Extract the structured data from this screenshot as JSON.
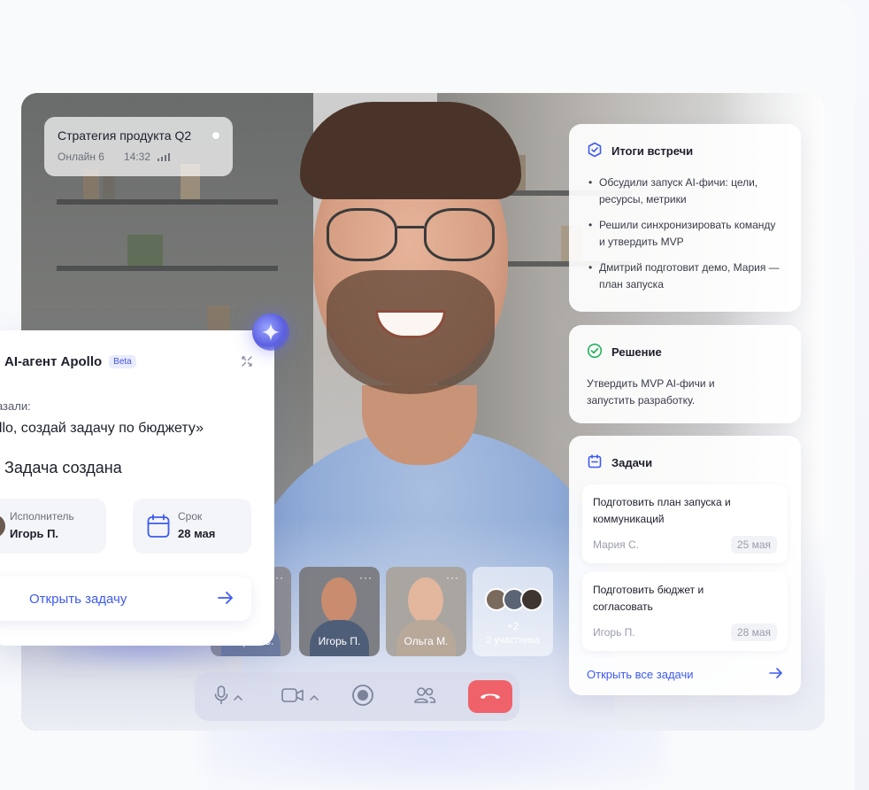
{
  "meeting": {
    "title": "Стратегия продукта Q2",
    "online": "Онлайн 6",
    "time": "14:32"
  },
  "summary": {
    "title": "Итоги встречи",
    "items": [
      "Обсудили запуск AI-фичи: цели, ресурсы, метрики",
      "Решили синхронизировать команду и утвердить MVP",
      "Дмитрий подготовит демо, Мария — план запуска"
    ]
  },
  "decision": {
    "title": "Решение",
    "text": "Утвердить MVP AI-фичи и запустить разработку."
  },
  "tasks": {
    "title": "Задачи",
    "items": [
      {
        "title": "Подготовить план запуска и коммуникаций",
        "assignee": "Мария С.",
        "date": "25 мая"
      },
      {
        "title": "Подготовить бюджет и согласовать",
        "assignee": "Игорь П.",
        "date": "28 мая"
      }
    ],
    "open_all": "Открыть все задачи"
  },
  "participants": {
    "tiles": [
      {
        "name": "Мария С."
      },
      {
        "name": "Игорь П."
      },
      {
        "name": "Ольга М."
      }
    ],
    "more_plus": "+2",
    "more_count": "2 участника"
  },
  "agent": {
    "name": "AI-агент Apollo",
    "badge": "Beta",
    "said_label": "казали:",
    "quote": "ollo, создай задачу по бюджету»",
    "created": "Задача создана",
    "assignee_label": "Исполнитель",
    "assignee_value": "Игорь П.",
    "due_label": "Срок",
    "due_value": "28 мая",
    "open_button": "Открыть задачу"
  },
  "colors": {
    "accent": "#3d5af1",
    "success": "#22b35e",
    "end_call": "#f0626a"
  },
  "icons": {
    "summary": "hexagon-check-icon",
    "decision": "check-circle-icon",
    "tasks": "calendar-icon",
    "mic": "microphone-icon",
    "camera": "video-camera-icon",
    "record": "record-icon",
    "people": "participants-icon",
    "end": "phone-hangup-icon"
  }
}
